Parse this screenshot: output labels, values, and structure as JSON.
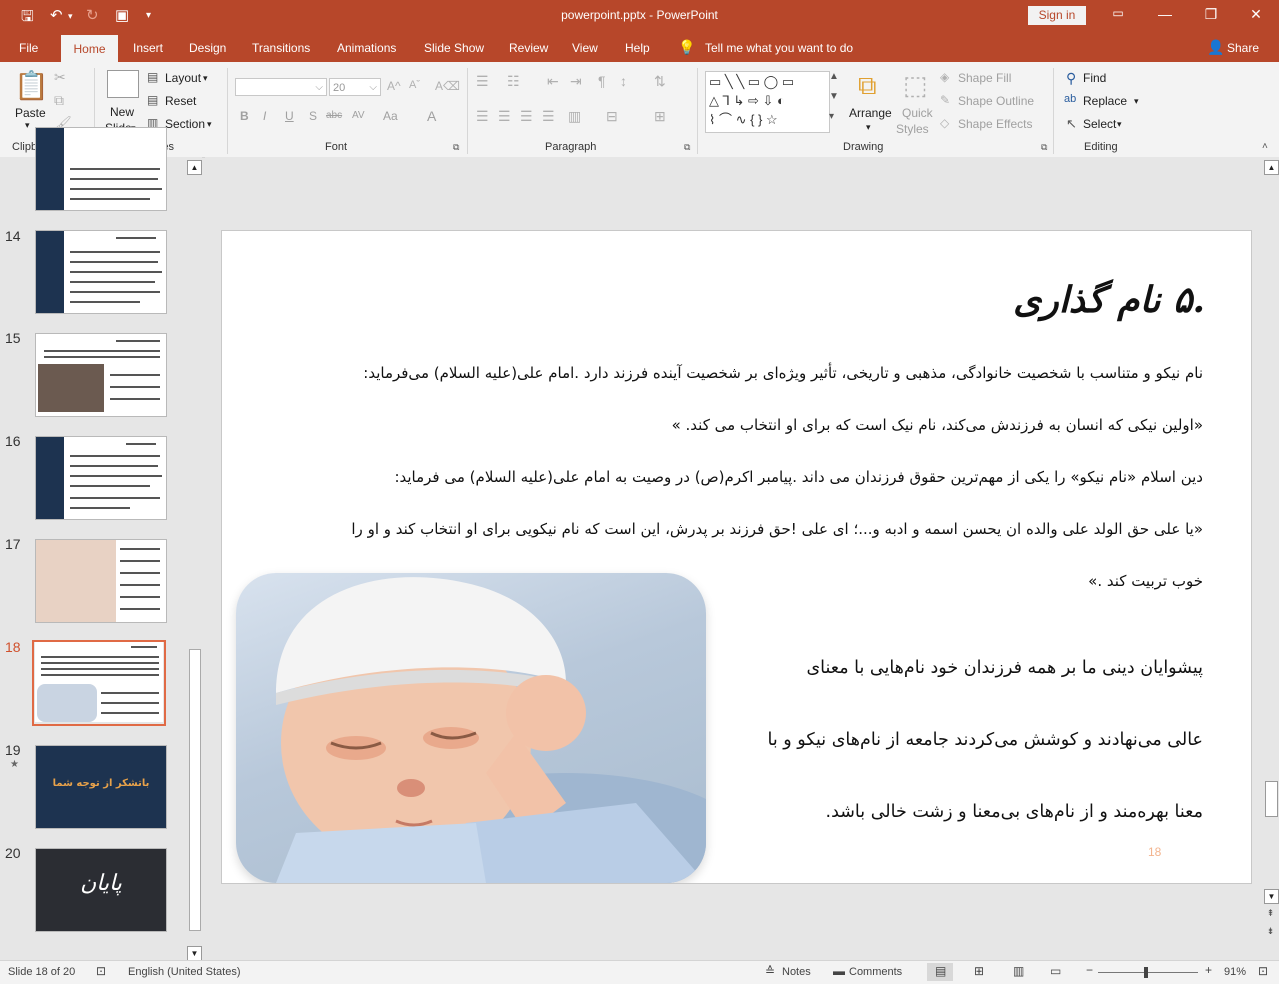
{
  "app": {
    "title": "powerpoint.pptx  -  PowerPoint",
    "sign_in": "Sign in",
    "accent": "#b7472a"
  },
  "tabs": {
    "file": "File",
    "home": "Home",
    "insert": "Insert",
    "design": "Design",
    "transitions": "Transitions",
    "animations": "Animations",
    "slideshow": "Slide Show",
    "review": "Review",
    "view": "View",
    "help": "Help",
    "tell_me": "Tell me what you want to do",
    "share": "Share"
  },
  "ribbon": {
    "clipboard": {
      "paste": "Paste",
      "label": "Clipboard"
    },
    "slides": {
      "new_slide_1": "New",
      "new_slide_2": "Slide",
      "layout": "Layout",
      "reset": "Reset",
      "section": "Section",
      "label": "Slides"
    },
    "font": {
      "font_size": "20",
      "label": "Font",
      "bold": "B",
      "italic": "I",
      "underline": "U",
      "shadow": "S",
      "strike": "abc",
      "spacing": "AV",
      "case": "Aa",
      "color": "A"
    },
    "paragraph": {
      "label": "Paragraph"
    },
    "drawing": {
      "arrange": "Arrange",
      "quick_styles_1": "Quick",
      "quick_styles_2": "Styles",
      "shape_fill": "Shape Fill",
      "shape_outline": "Shape Outline",
      "shape_effects": "Shape Effects",
      "label": "Drawing"
    },
    "editing": {
      "find": "Find",
      "replace": "Replace",
      "select": "Select",
      "label": "Editing"
    }
  },
  "thumbnails": [
    {
      "num": "14",
      "star": "",
      "kind": "text-blue"
    },
    {
      "num": "15",
      "star": "",
      "kind": "photo"
    },
    {
      "num": "16",
      "star": "",
      "kind": "text-blue"
    },
    {
      "num": "17",
      "star": "",
      "kind": "photo"
    },
    {
      "num": "18",
      "star": "",
      "kind": "photo",
      "selected": true
    },
    {
      "num": "19",
      "star": "★",
      "kind": "thanks",
      "text": "باتشکر از توجه شما"
    },
    {
      "num": "20",
      "star": "",
      "kind": "end",
      "text": "پایان"
    }
  ],
  "slide": {
    "title": ".۵ نام گذاری",
    "p1": "نام نیکو و متناسب با شخصیت خانوادگی، مذهبی و تاریخی، تأثیر ویژه‌ای بر شخصیت آینده فرزند دارد .امام علی(علیه السلام) می‌فرماید:",
    "p2": "«اولین نیکی که انسان به فرزندش می‌کند، نام نیک است که برای او انتخاب می کند. »",
    "p3": "دین اسلام «نام نیکو» را یکی از مهم‌ترین حقوق فرزندان می داند .پیامبر اکرم(ص) در وصیت به امام علی(علیه السلام) می فرماید:",
    "p4": "«یا علی حق الولد علی والده ان یحسن اسمه و ادبه و...؛ ای علی !حق فرزند بر پدرش، این است که نام نیکویی برای او انتخاب کند و او را",
    "p5": "خوب تربیت کند .»",
    "p6": "پیشوایان دینی ما بر همه فرزندان خود نام‌هایی با معنای",
    "p7": "عالی می‌نهادند و کوشش می‌کردند جامعه از نام‌های نیکو و با",
    "p8": "معنا بهره‌مند و از نام‌های بی‌معنا و زشت خالی باشد.",
    "slide_number": "18"
  },
  "status": {
    "slide_of": "Slide 18 of 20",
    "language": "English (United States)",
    "notes": "Notes",
    "comments": "Comments",
    "zoom": "91%"
  }
}
